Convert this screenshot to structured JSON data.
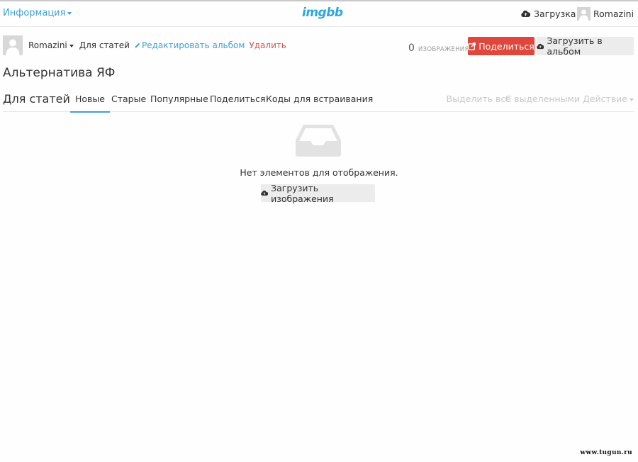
{
  "topbar": {
    "info_label": "Информация",
    "logo": "imgbb",
    "upload_label": "Загрузка",
    "username": "Romazini"
  },
  "album": {
    "owner": "Romazini",
    "album_name": "Для статей",
    "edit_label": "Редактировать альбом",
    "delete_label": "Удалить",
    "image_count": "0",
    "image_count_label": "ИЗОБРАЖЕНИЯ",
    "share_label": "Поделиться",
    "upload_to_album_label": "Загрузить в альбом",
    "title": "Альтернатива ЯФ"
  },
  "tabs": {
    "section_name": "Для статей",
    "items": [
      {
        "label": "Новые",
        "active": true
      },
      {
        "label": "Старые"
      },
      {
        "label": "Популярные"
      },
      {
        "label": "Поделиться"
      },
      {
        "label": "Коды для встраивания"
      }
    ],
    "select_all_label": "Выделить все",
    "separator": "·",
    "bulk_action_label": "С выделенными Действие"
  },
  "empty_state": {
    "message": "Нет элементов для отображения.",
    "upload_button_label": "Загрузить изображения"
  },
  "watermark": "www.tugun.ru",
  "colors": {
    "accent": "#3f9fd6",
    "danger": "#e0473c",
    "delete_text": "#d9534f",
    "logo": "#2da6df",
    "muted": "#c8c8c8"
  },
  "icons": [
    "chevron-down-icon",
    "cloud-upload-icon",
    "user-avatar-icon",
    "pencil-icon",
    "share-icon",
    "inbox-tray-icon"
  ]
}
